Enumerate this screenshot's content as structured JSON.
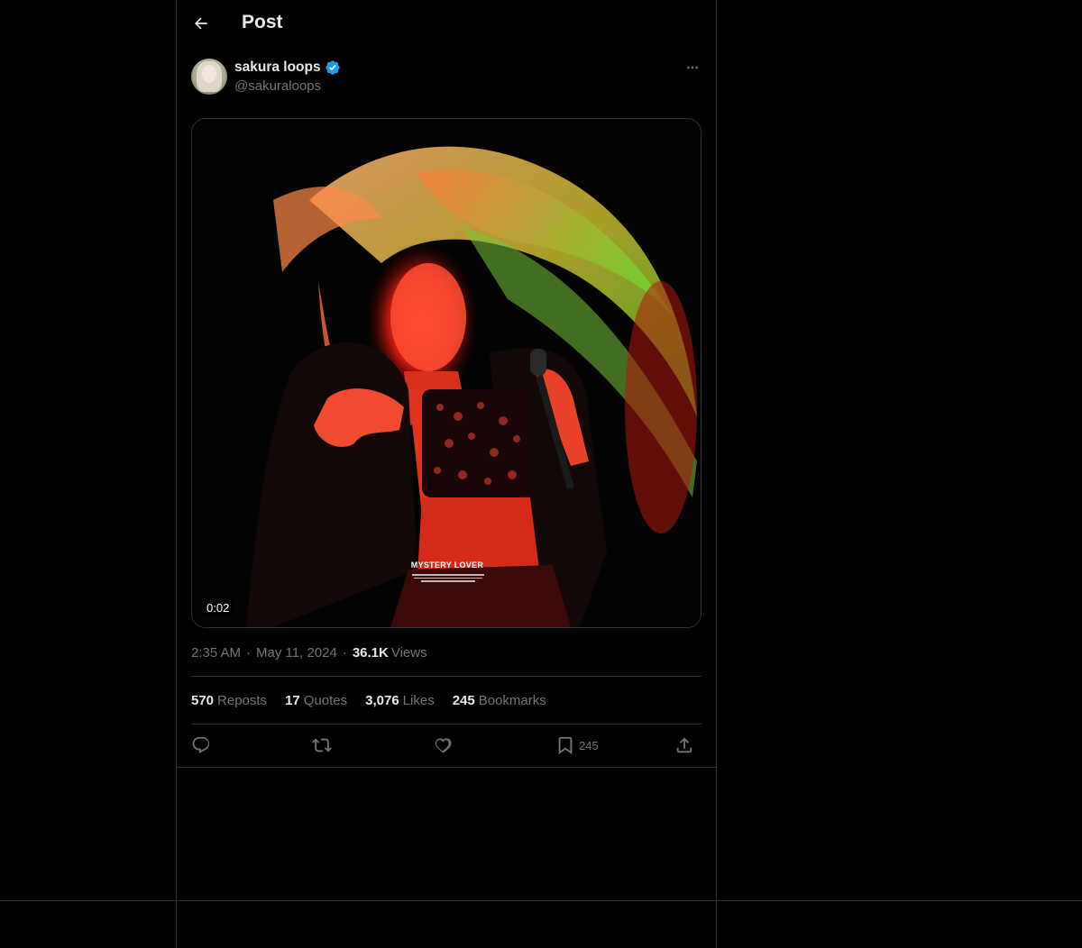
{
  "header": {
    "title": "Post",
    "back_icon": "arrow-left-icon"
  },
  "author": {
    "display_name": "sakura loops",
    "handle": "@sakuraloops",
    "verified": true,
    "verified_color": "#1d9bf0"
  },
  "media": {
    "duration": "0:02",
    "caption": "MYSTERY LOVER"
  },
  "meta": {
    "time": "2:35 AM",
    "separator": "·",
    "date": "May 11, 2024",
    "views_count": "36.1K",
    "views_label": "Views"
  },
  "stats": [
    {
      "count": "570",
      "label": "Reposts"
    },
    {
      "count": "17",
      "label": "Quotes"
    },
    {
      "count": "3,076",
      "label": "Likes"
    },
    {
      "count": "245",
      "label": "Bookmarks"
    }
  ],
  "actions": {
    "reply_icon": "reply-icon",
    "repost_icon": "repost-icon",
    "like_icon": "heart-icon",
    "bookmark_icon": "bookmark-icon",
    "bookmark_count": "245",
    "share_icon": "share-icon"
  },
  "colors": {
    "background": "#000000",
    "text": "#e7e9ea",
    "muted": "#71767b",
    "border": "#2f3336"
  }
}
